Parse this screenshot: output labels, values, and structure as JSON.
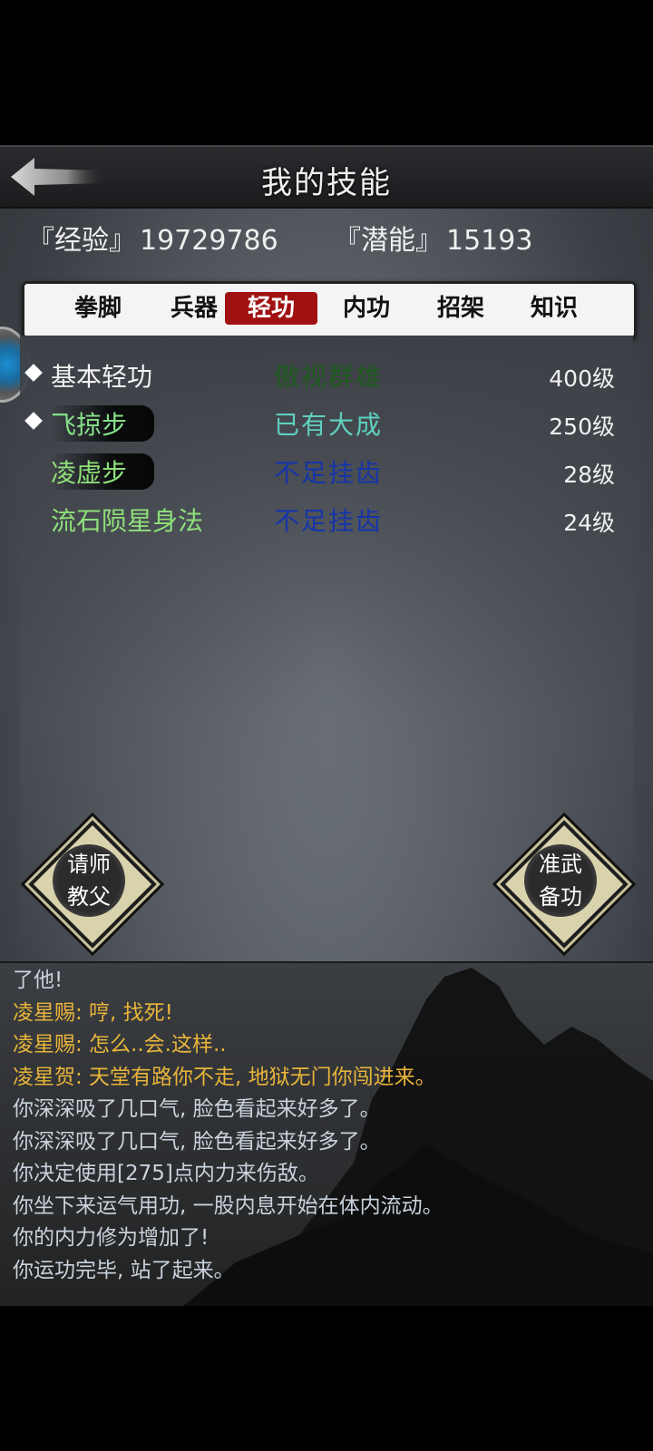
{
  "header": {
    "title": "我的技能"
  },
  "stats": {
    "exp_label": "『经验』",
    "exp_value": "19729786",
    "pot_label": "『潜能』",
    "pot_value": "15193"
  },
  "tabs": [
    {
      "label": "拳脚",
      "active": false
    },
    {
      "label": "兵器",
      "active": false
    },
    {
      "label": "轻功",
      "active": true
    },
    {
      "label": "内功",
      "active": false
    },
    {
      "label": "招架",
      "active": false
    },
    {
      "label": "知识",
      "active": false
    }
  ],
  "skills": [
    {
      "name": "基本轻功",
      "level_text": "傲视群雄",
      "grade": "400级",
      "name_color": "#f2f2f2",
      "level_color": "#1e5a1e",
      "marked": true
    },
    {
      "name": "飞掠步",
      "level_text": "已有大成",
      "grade": "250级",
      "name_color": "#86e08a",
      "level_color": "#5fd0c0",
      "marked": true
    },
    {
      "name": "凌虚步",
      "level_text": "不足挂齿",
      "grade": "28级",
      "name_color": "#8fe07a",
      "level_color": "#1535a8",
      "marked": false
    },
    {
      "name": "流石陨星身法",
      "level_text": "不足挂齿",
      "grade": "24级",
      "name_color": "#8fe07a",
      "level_color": "#1535a8",
      "marked": false
    }
  ],
  "buttons": {
    "teacher": {
      "line1": "请师",
      "line2": "教父"
    },
    "prepare": {
      "line1": "准武",
      "line2": "备功"
    }
  },
  "log": [
    {
      "text": "了他!",
      "color": "#c9d2dc"
    },
    {
      "text": "凌星赐: 哼, 找死!",
      "color": "#e8b43a"
    },
    {
      "text": "凌星赐: 怎么..会.这样..",
      "color": "#e8b43a"
    },
    {
      "text": "凌星贺: 天堂有路你不走, 地狱无门你闯进来。",
      "color": "#e8b43a"
    },
    {
      "text": "你深深吸了几口气, 脸色看起来好多了。",
      "color": "#c9d2dc"
    },
    {
      "text": "你深深吸了几口气, 脸色看起来好多了。",
      "color": "#c9d2dc"
    },
    {
      "text": "你决定使用[275]点内力来伤敌。",
      "color": "#c9d2dc"
    },
    {
      "text": "你坐下来运气用功, 一股内息开始在体内流动。",
      "color": "#c9d2dc"
    },
    {
      "text": "你的内力修为增加了!",
      "color": "#c9d2dc"
    },
    {
      "text": "你运功完毕, 站了起来。",
      "color": "#c9d2dc"
    }
  ],
  "icons": {
    "back": "back-arrow-icon",
    "orb": "side-orb-icon"
  }
}
